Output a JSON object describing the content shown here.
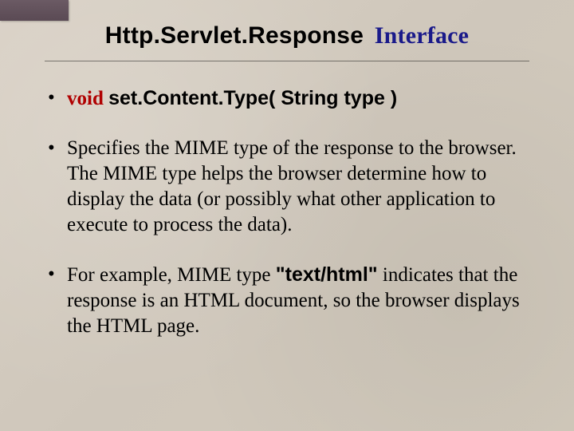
{
  "title": {
    "class_part": "Http.Servlet.Response",
    "interface_part": "Interface"
  },
  "bullets": {
    "method": {
      "keyword": "void",
      "signature": "set.Content.Type( String type )"
    },
    "desc1_pre": "Specifies the MIME type of the response to the browser. The MIME type helps the browser determine how to display the data (or possibly what other application to execute to process the data).",
    "desc2_pre": "For example, MIME type ",
    "desc2_mime": "\"text/html\"",
    "desc2_post": " indicates that the response is an HTML document, so the browser displays the HTML page."
  }
}
